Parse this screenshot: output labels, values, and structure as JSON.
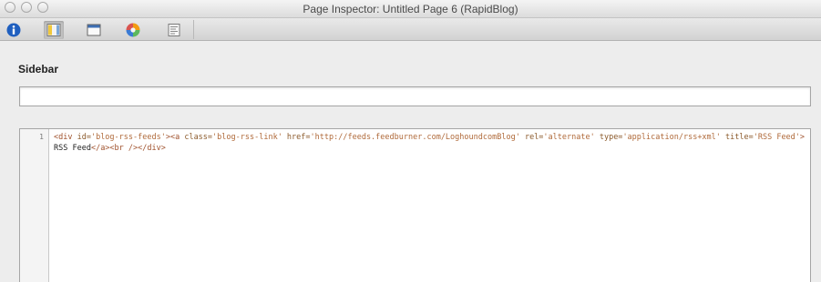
{
  "window": {
    "title": "Page Inspector: Untitled Page 6 (RapidBlog)"
  },
  "toolbar": {
    "buttons": [
      {
        "icon": "info-icon",
        "active": true
      },
      {
        "icon": "page-layout-icon",
        "active": false
      },
      {
        "icon": "window-icon",
        "active": false
      },
      {
        "icon": "color-wheel-icon",
        "active": false
      },
      {
        "icon": "html-snippet-icon",
        "active": false
      }
    ]
  },
  "sidebar": {
    "label": "Sidebar",
    "title_field_value": ""
  },
  "code_editor": {
    "line_number": "1",
    "tokens": {
      "t1": "<div ",
      "a1": "id=",
      "s1": "'blog-rss-feeds'",
      "t2": "><a ",
      "a2": "class=",
      "s2": "'blog-rss-link'",
      "a3": " href=",
      "s3": "'http://feeds.feedburner.com/LoghoundcomBlog'",
      "a4": " rel=",
      "s4": "'alternate'",
      "a5": " type=",
      "s5": "'application/rss+xml'",
      "a6": " title=",
      "s6": "'RSS Feed'",
      "t3": ">",
      "txt": "RSS Feed",
      "t4": "</a><br />",
      "t5": "</div>"
    }
  },
  "colors": {
    "tag": "#a0522d",
    "attribute": "#8b5a2b",
    "string": "#b06a3a",
    "background": "#ededed"
  }
}
